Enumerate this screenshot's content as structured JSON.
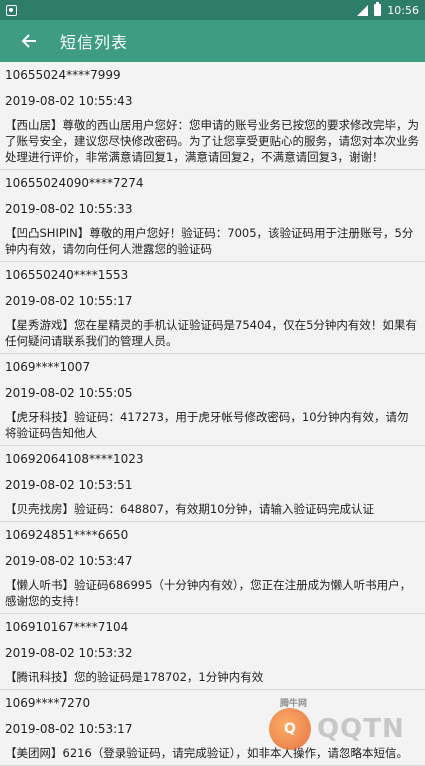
{
  "status_bar": {
    "time": "10:56"
  },
  "app_bar": {
    "title": "短信列表"
  },
  "messages": [
    {
      "sender": "10655024****7999",
      "time": "2019-08-02 10:55:43",
      "body": "【西山居】尊敬的西山居用户您好：您申请的账号业务已按您的要求修改完毕，为了账号安全，建议您尽快修改密码。为了让您享受更贴心的服务，请您对本次业务处理进行评价，非常满意请回复1，满意请回复2，不满意请回复3，谢谢！"
    },
    {
      "sender": "10655024090****7274",
      "time": "2019-08-02 10:55:33",
      "body": "【凹凸SHIPIN】尊敬的用户您好！验证码：7005，该验证码用于注册账号，5分钟内有效，请勿向任何人泄露您的验证码"
    },
    {
      "sender": "106550240****1553",
      "time": "2019-08-02 10:55:17",
      "body": "【星秀游戏】您在星精灵的手机认证验证码是75404，仅在5分钟内有效！如果有任何疑问请联系我们的管理人员。"
    },
    {
      "sender": "1069****1007",
      "time": "2019-08-02 10:55:05",
      "body": "【虎牙科技】验证码：417273，用于虎牙帐号修改密码，10分钟内有效，请勿将验证码告知他人"
    },
    {
      "sender": "10692064108****1023",
      "time": "2019-08-02 10:53:51",
      "body": "【贝壳找房】验证码：648807，有效期10分钟，请输入验证码完成认证"
    },
    {
      "sender": "106924851****6650",
      "time": "2019-08-02 10:53:47",
      "body": "【懒人听书】验证码686995（十分钟内有效），您正在注册成为懒人听书用户，感谢您的支持！"
    },
    {
      "sender": "106910167****7104",
      "time": "2019-08-02 10:53:32",
      "body": "【腾讯科技】您的验证码是178702，1分钟内有效"
    },
    {
      "sender": "1069****7270",
      "time": "2019-08-02 10:53:17",
      "body": "【美团网】6216（登录验证码，请完成验证），如非本人操作，请忽略本短信。"
    }
  ],
  "watermark": {
    "small": "腾牛网",
    "text": "QQTN",
    "logo_letter": "Q"
  },
  "colors": {
    "status_bar": "#2e7d6a",
    "app_bar": "#3d9c82",
    "background": "#f3f3f3"
  },
  "icons": {
    "back": "arrow-left-icon",
    "notification": "notification-icon",
    "signal": "signal-icon",
    "battery": "battery-icon"
  }
}
